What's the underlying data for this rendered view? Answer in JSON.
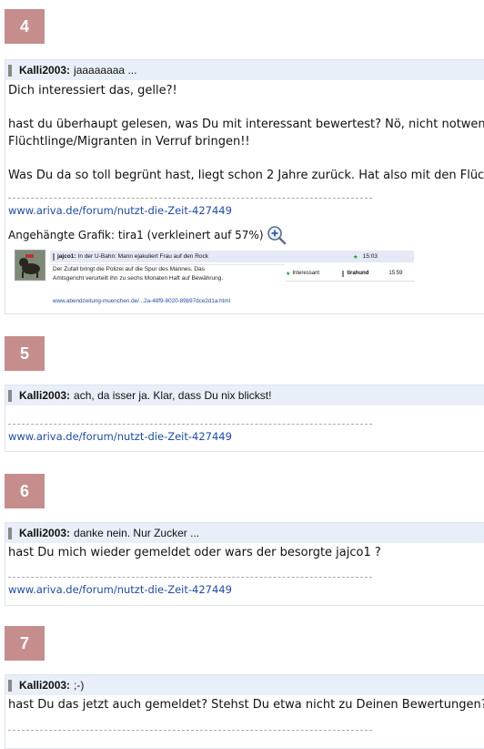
{
  "posts": [
    {
      "number": "4",
      "author": "Kalli2003:",
      "subject": "jaaaaaaaa ...",
      "paragraphs": [
        "Dich interessiert das, gelle?!",
        "hast du überhaupt gelesen, was Du mit interessant bewertest? Nö, nicht notwendi",
        "Flüchtlinge/Migranten in Verruf bringen!!",
        "Was Du da so toll begrünt hast, liegt schon 2 Jahre zurück. Hat also mit den Flüchtl"
      ],
      "link": "www.ariva.de/forum/nutzt-die-Zeit-427449",
      "attachment": {
        "label": "Angehängte Grafik: tira1 (verkleinert auf 57%)",
        "thumb": {
          "author": "jajco1:",
          "subject": "In der U-Bahn: Mann ejakuliert Frau auf den Rock",
          "time": "15:03",
          "body_line1": "Der Zufall bringt die Polizei auf die Spur des Mannes. Das",
          "body_line2": "Amtsgericht verurteilt ihn zu sechs Monaten Haft auf Bewährung.",
          "link": "www.abendzeitung-muenchen.de/...2a-48f9-8020-89b97dce2d1a.html",
          "rating_label": "Interessant",
          "rater": "tirahund",
          "rating_time": "15:59"
        }
      }
    },
    {
      "number": "5",
      "author": "Kalli2003:",
      "subject": "ach, da isser ja. Klar, dass Du nix blickst!",
      "link": "www.ariva.de/forum/nutzt-die-Zeit-427449"
    },
    {
      "number": "6",
      "author": "Kalli2003:",
      "subject": "danke nein. Nur Zucker ...",
      "paragraphs": [
        "hast Du mich wieder gemeldet oder wars der besorgte jajco1 ?"
      ],
      "link": "www.ariva.de/forum/nutzt-die-Zeit-427449"
    },
    {
      "number": "7",
      "author": "Kalli2003:",
      "subject": ";-)",
      "paragraphs": [
        "hast Du das jetzt auch gemeldet? Stehst Du etwa nicht zu Deinen Bewertungen?"
      ]
    }
  ],
  "colors": {
    "number_badge": "#c58e8d",
    "post_header": "#e9eff8",
    "link": "#1f4a9e",
    "star": "#2d9b2d"
  },
  "icons": {
    "zoom": "magnifier-plus-icon",
    "star": "star-icon"
  }
}
